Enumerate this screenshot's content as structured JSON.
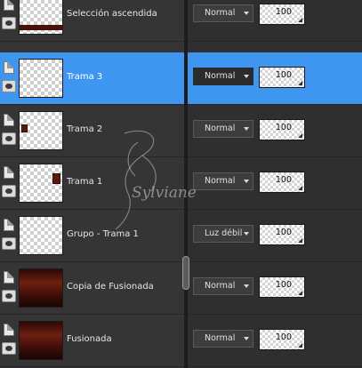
{
  "layers": [
    {
      "name": "Selección ascendida",
      "blend": "Normal",
      "opacity": "100",
      "selected": false,
      "thumb": "dark-band"
    },
    {
      "name": "Trama 3",
      "blend": "Normal",
      "opacity": "100",
      "selected": true,
      "thumb": "transparent"
    },
    {
      "name": "Trama 2",
      "blend": "Normal",
      "opacity": "100",
      "selected": false,
      "thumb": "mark-left"
    },
    {
      "name": "Trama 1",
      "blend": "Normal",
      "opacity": "100",
      "selected": false,
      "thumb": "mark-right"
    },
    {
      "name": "Grupo - Trama 1",
      "blend": "Luz débil",
      "opacity": "100",
      "selected": false,
      "thumb": "transparent"
    },
    {
      "name": "Copia de Fusionada",
      "blend": "Normal",
      "opacity": "100",
      "selected": false,
      "thumb": "dark"
    },
    {
      "name": "Fusionada",
      "blend": "Normal",
      "opacity": "100",
      "selected": false,
      "thumb": "dark"
    }
  ],
  "watermark": "Sylviane",
  "colors": {
    "selected": "#3f96f0",
    "panel": "#353535",
    "panel_right": "#2f2f2f"
  }
}
